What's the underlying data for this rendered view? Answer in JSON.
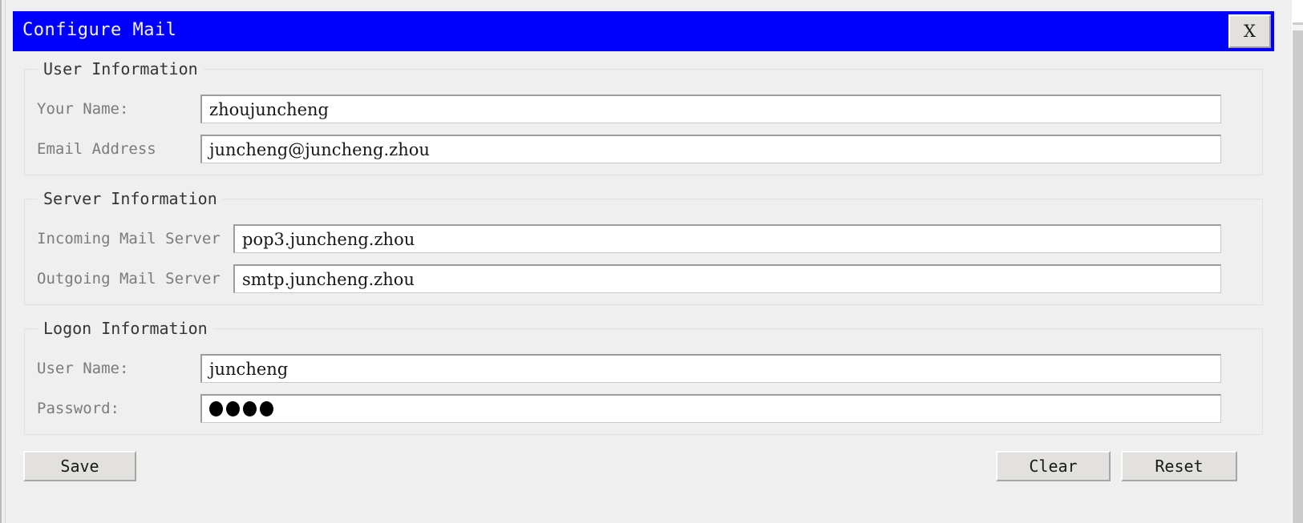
{
  "window": {
    "title": "Configure Mail",
    "close_label": "X",
    "titlebar_color": "#0000ff",
    "titlebar_text_color": "#f2f2f2",
    "background_color": "#efefef"
  },
  "groups": {
    "user": {
      "title": "User Information",
      "fields": [
        {
          "label": "Your Name:",
          "value": "zhoujuncheng",
          "placeholder": ""
        },
        {
          "label": "Email Address",
          "value": "juncheng@juncheng.zhou",
          "placeholder": ""
        }
      ]
    },
    "server": {
      "title": "Server Information",
      "fields": [
        {
          "label": "Incoming Mail Server",
          "value": "pop3.juncheng.zhou",
          "placeholder": ""
        },
        {
          "label": "Outgoing Mail Server",
          "value": "smtp.juncheng.zhou",
          "placeholder": ""
        }
      ]
    },
    "logon": {
      "title": "Logon Information",
      "fields": [
        {
          "label": "User Name:",
          "value": "juncheng",
          "placeholder": ""
        },
        {
          "label": "Password:",
          "value": "",
          "masked_char_count": 4,
          "placeholder": ""
        }
      ]
    }
  },
  "buttons": {
    "save": "Save",
    "clear": "Clear",
    "reset": "Reset"
  }
}
